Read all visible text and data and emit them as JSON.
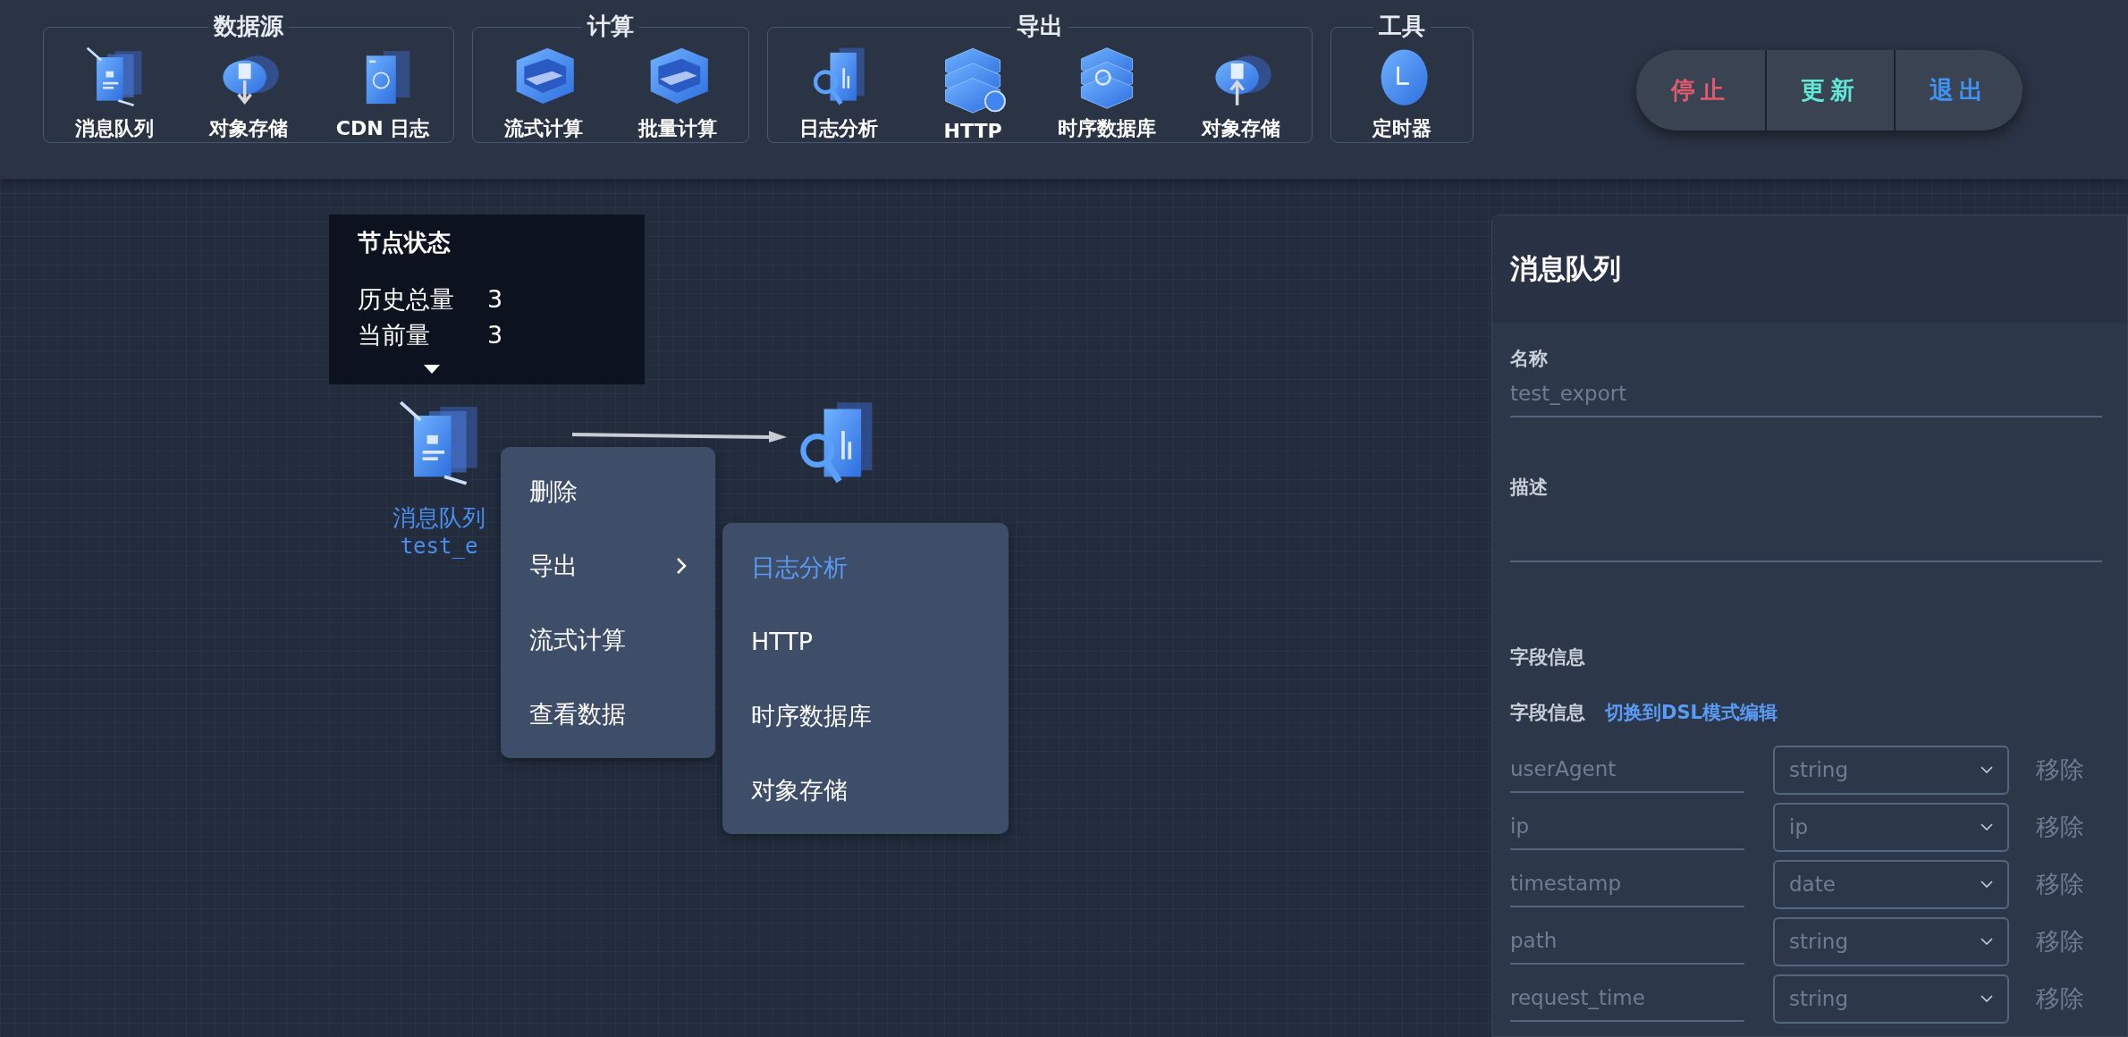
{
  "toolbar": {
    "groups": [
      {
        "title": "数据源",
        "items": [
          {
            "label": "消息队列",
            "kind": "doc"
          },
          {
            "label": "对象存储",
            "kind": "cloud-down"
          },
          {
            "label": "CDN 日志",
            "kind": "doc-globe"
          }
        ]
      },
      {
        "title": "计算",
        "items": [
          {
            "label": "流式计算",
            "kind": "panel"
          },
          {
            "label": "批量计算",
            "kind": "panel"
          }
        ]
      },
      {
        "title": "导出",
        "items": [
          {
            "label": "日志分析",
            "kind": "doc-search"
          },
          {
            "label": "HTTP",
            "kind": "stack-globe"
          },
          {
            "label": "时序数据库",
            "kind": "stack-clock"
          },
          {
            "label": "对象存储",
            "kind": "cloud-up"
          }
        ]
      },
      {
        "title": "工具",
        "items": [
          {
            "label": "定时器",
            "kind": "clock"
          }
        ]
      }
    ],
    "actions": [
      {
        "label": "停止",
        "kind": "stop"
      },
      {
        "label": "更新",
        "kind": "update"
      },
      {
        "label": "退出",
        "kind": "exit"
      }
    ]
  },
  "canvas": {
    "tooltip": {
      "title": "节点状态",
      "rows": [
        {
          "label": "历史总量",
          "value": "3"
        },
        {
          "label": "当前量",
          "value": "3"
        }
      ]
    },
    "nodes": [
      {
        "kind": "doc",
        "name": "消息队列",
        "subtitle": "test_e"
      },
      {
        "kind": "doc-search"
      }
    ],
    "context_menu": {
      "items": [
        {
          "label": "删除",
          "submenu": false
        },
        {
          "label": "导出",
          "submenu": true
        },
        {
          "label": "流式计算",
          "submenu": false
        },
        {
          "label": "查看数据",
          "submenu": false
        }
      ]
    },
    "submenu": {
      "items": [
        {
          "label": "日志分析",
          "selected": true
        },
        {
          "label": "HTTP",
          "selected": false
        },
        {
          "label": "时序数据库",
          "selected": false
        },
        {
          "label": "对象存储",
          "selected": false
        }
      ]
    }
  },
  "panel": {
    "title": "消息队列",
    "name_label": "名称",
    "name_value": "test_export",
    "description_label": "描述",
    "fields_heading": "字段信息",
    "fields_label": "字段信息",
    "dsl_link": "切换到DSL模式编辑",
    "fields": [
      {
        "name": "userAgent",
        "type": "string",
        "action": "移除"
      },
      {
        "name": "ip",
        "type": "ip",
        "action": "移除"
      },
      {
        "name": "timestamp",
        "type": "date",
        "action": "移除"
      },
      {
        "name": "path",
        "type": "string",
        "action": "移除"
      },
      {
        "name": "request_time",
        "type": "string",
        "action": "移除"
      }
    ]
  }
}
